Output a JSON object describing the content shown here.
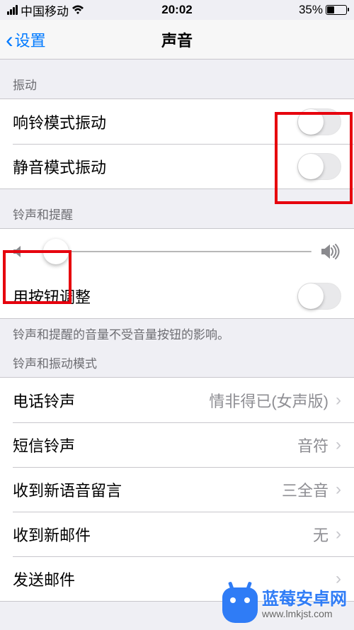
{
  "status": {
    "carrier": "中国移动",
    "time": "20:02",
    "battery": "35%"
  },
  "nav": {
    "back": "设置",
    "title": "声音"
  },
  "section_vibrate": {
    "header": "振动",
    "ring_vibrate": "响铃模式振动",
    "silent_vibrate": "静音模式振动"
  },
  "section_ringer": {
    "header": "铃声和提醒",
    "change_with_buttons": "用按钮调整",
    "footer": "铃声和提醒的音量不受音量按钮的影响。"
  },
  "section_patterns": {
    "header": "铃声和振动模式",
    "items": [
      {
        "label": "电话铃声",
        "value": "情非得已(女声版)"
      },
      {
        "label": "短信铃声",
        "value": "音符"
      },
      {
        "label": "收到新语音留言",
        "value": "三全音"
      },
      {
        "label": "收到新邮件",
        "value": "无"
      },
      {
        "label": "发送邮件",
        "value": ""
      }
    ]
  },
  "watermark": {
    "line1": "蓝莓安卓网",
    "line2": "www.lmkjst.com"
  }
}
